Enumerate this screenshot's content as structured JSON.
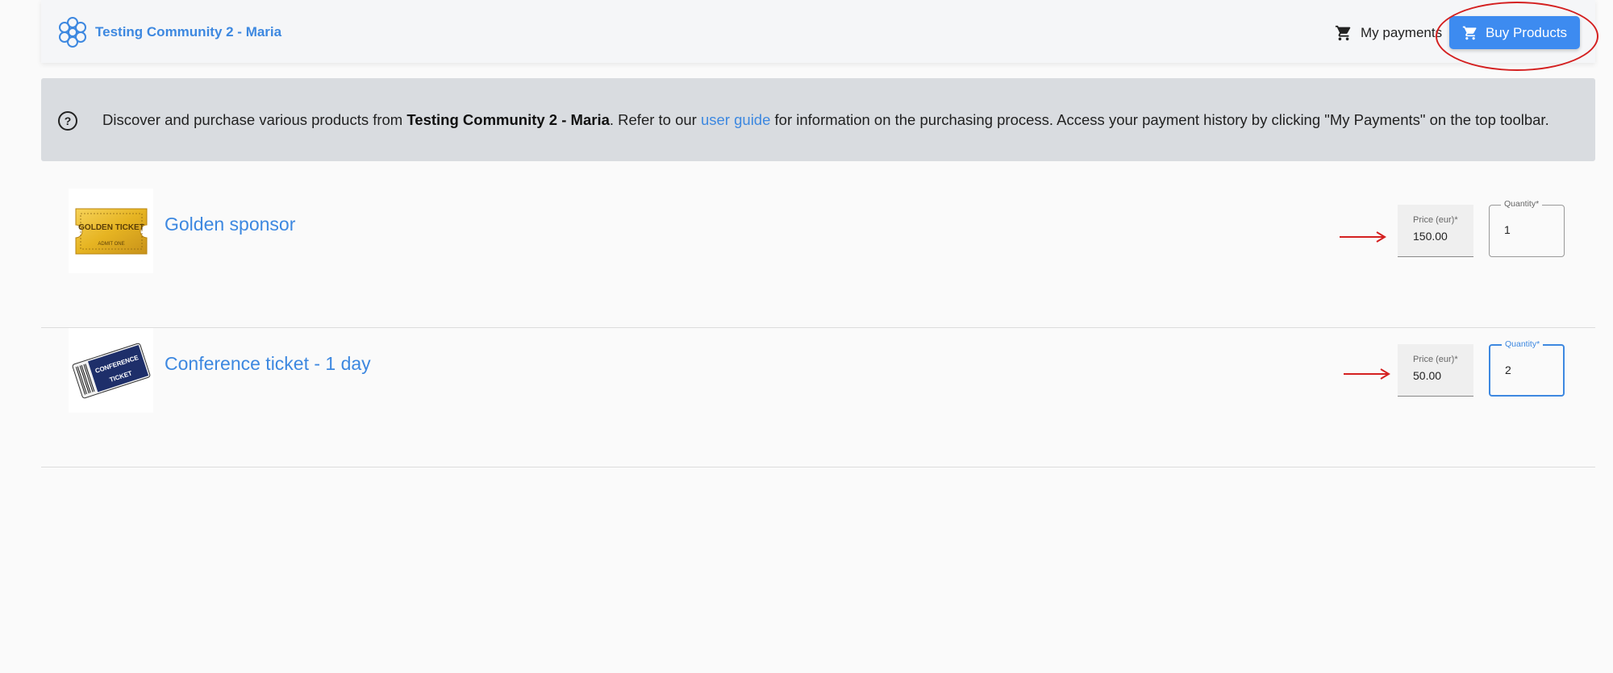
{
  "toolbar": {
    "community_name": "Testing Community 2 - Maria",
    "my_payments_label": "My payments",
    "buy_products_label": "Buy Products",
    "accent_color": "#3d8bf0"
  },
  "info": {
    "text_before": "Discover and purchase various products from ",
    "community_bold": "Testing Community 2 - Maria",
    "text_middle": ". Refer to our ",
    "link_text": "user guide",
    "text_after": " for information on the purchasing process. Access your payment history by clicking \"My Payments\" on the top toolbar."
  },
  "products": [
    {
      "title": "Golden sponsor",
      "image_text_top": "GOLDEN TICKET",
      "image_text_bottom": "ADMIT ONE",
      "price_label": "Price (eur)*",
      "price_value": "150.00",
      "quantity_label": "Quantity*",
      "quantity_value": "1"
    },
    {
      "title": "Conference ticket - 1 day",
      "image_text_top": "CONFERENCE",
      "image_text_bottom": "TICKET",
      "price_label": "Price (eur)*",
      "price_value": "50.00",
      "quantity_label": "Quantity*",
      "quantity_value": "2"
    }
  ]
}
